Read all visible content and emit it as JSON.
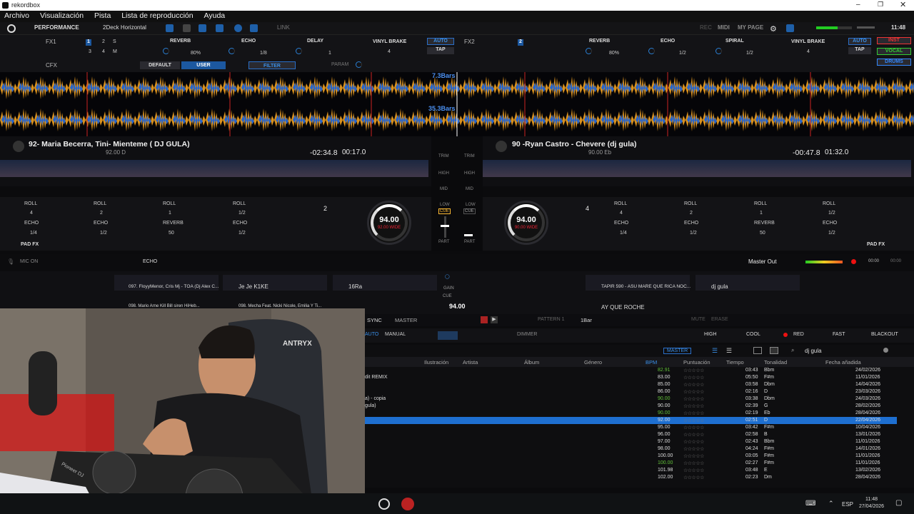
{
  "window": {
    "title": "rekordbox"
  },
  "menu": [
    "Archivo",
    "Visualización",
    "Pista",
    "Lista de reproducción",
    "Ayuda"
  ],
  "toolbar": {
    "mode": "PERFORMANCE",
    "layout": "2Deck Horizontal",
    "link": "LINK",
    "rec": "REC",
    "midi": "MIDI",
    "mypage": "MY PAGE",
    "clock": "11:48"
  },
  "fx": {
    "fx1": "FX1",
    "fx2": "FX2",
    "cfx": "CFX",
    "fx1_slots": [
      {
        "name": "REVERB",
        "val": "80%"
      },
      {
        "name": "ECHO",
        "val": "1/8"
      },
      {
        "name": "DELAY",
        "val": "1"
      },
      {
        "name": "VINYL BRAKE",
        "val": "4"
      }
    ],
    "fx2_slots": [
      {
        "name": "REVERB",
        "val": "80%"
      },
      {
        "name": "ECHO",
        "val": "1/2"
      },
      {
        "name": "SPIRAL",
        "val": "1/2"
      },
      {
        "name": "VINYL BRAKE",
        "val": "4"
      }
    ],
    "auto": "AUTO",
    "tap": "TAP",
    "default": "DEFAULT",
    "user": "USER",
    "filter": "FILTER",
    "param": "PARAM",
    "inst": "INST",
    "vocal": "VOCAL",
    "drums": "DRUMS"
  },
  "waves": {
    "bars1": "7.3Bars",
    "bars2": "35.3Bars"
  },
  "deck1": {
    "num": "1",
    "title": "92- Maria Becerra, Tini- Mienteme ( DJ GULA)",
    "sub": "92.00 D",
    "remain": "-02:34.8",
    "elapsed": "00:17.0",
    "bpm": "94.00",
    "bpm_sub": "92.00 WIDE",
    "loop": "2",
    "pads": [
      [
        "ROLL",
        "4"
      ],
      [
        "ROLL",
        "2"
      ],
      [
        "ROLL",
        "1"
      ],
      [
        "ROLL",
        "1/2"
      ],
      [
        "ECHO",
        "1/4"
      ],
      [
        "ECHO",
        "1/2"
      ],
      [
        "REVERB",
        "50"
      ],
      [
        "ECHO",
        "1/2"
      ]
    ]
  },
  "deck2": {
    "num": "2",
    "title": "90 -Ryan Castro - Chevere (dj gula)",
    "sub": "90.00 Eb",
    "remain": "-00:47.8",
    "elapsed": "01:32.0",
    "bpm": "94.00",
    "bpm_sub": "90.00 WIDE",
    "loop": "4",
    "pads": [
      [
        "ROLL",
        "4"
      ],
      [
        "ROLL",
        "2"
      ],
      [
        "ROLL",
        "1"
      ],
      [
        "ROLL",
        "1/2"
      ],
      [
        "ECHO",
        "1/4"
      ],
      [
        "ECHO",
        "1/2"
      ],
      [
        "REVERB",
        "50"
      ],
      [
        "ECHO",
        "1/2"
      ]
    ]
  },
  "mixer": {
    "trim": "TRIM",
    "high": "HIGH",
    "mid": "MID",
    "low": "LOW",
    "cue": "CUE",
    "part": "PART"
  },
  "strip": {
    "pad_fx": "PAD FX",
    "mic_on": "MIC ON",
    "echo": "ECHO",
    "master_out": "Master Out",
    "time1": "00:00",
    "time2": "00:00"
  },
  "sampler": {
    "left": [
      "097. FloyyMenor, Cris Mj - TOA (Dj Alex C...",
      "Je Je K1KE",
      "16Ra",
      "098. Mario Arne Kill Bill siren HiHeb...",
      "098. Mecha Feat. Nicki Nicole, Emilia Y Ti..."
    ],
    "right": [
      "TAPIR 590 - ASU MARE QUE RICA NOC...",
      "dj gula",
      "AY QUE ROCHE"
    ],
    "gain": "GAIN",
    "cue": "CUE",
    "bpm": "94.00"
  },
  "seq": {
    "sync": "SYNC",
    "master": "MASTER",
    "pattern": "PATTERN 1",
    "bar": "1Bar",
    "mute": "MUTE",
    "erase": "ERASE"
  },
  "filterbar": {
    "auto": "AUTO",
    "manual": "MANUAL",
    "dimmer": "DIMMER",
    "high": "HIGH",
    "cool": "COOL",
    "red": "RED",
    "fast": "FAST",
    "blackout": "BLACKOUT"
  },
  "browser": {
    "master": "MASTER",
    "search": "dj gula",
    "cols": [
      "Ilustración",
      "Artista",
      "Álbum",
      "Género",
      "BPM",
      "Puntuación",
      "Tiempo",
      "Tonalidad",
      "Fecha añadida"
    ],
    "rows": [
      [
        "",
        "82.91",
        "03:43",
        "Bbm",
        "24/02/2026",
        "#63c23a"
      ],
      [
        "dit REMIX",
        "83.00",
        "05:50",
        "F#m",
        "11/01/2026",
        ""
      ],
      [
        "",
        "85.00",
        "03:58",
        "Dbm",
        "14/04/2026",
        ""
      ],
      [
        "",
        "86.00",
        "02:16",
        "D",
        "23/03/2026",
        ""
      ],
      [
        "a) - copia",
        "90.00",
        "03:38",
        "Dbm",
        "24/03/2026",
        "#63c23a"
      ],
      [
        "gula)",
        "90.00",
        "02:39",
        "G",
        "28/02/2026",
        ""
      ],
      [
        "",
        "90.00",
        "02:19",
        "Eb",
        "28/04/2026",
        "#63c23a"
      ],
      [
        "",
        "92.00",
        "02:51",
        "D",
        "22/04/2026",
        "sel"
      ],
      [
        "",
        "95.00",
        "03:42",
        "F#m",
        "10/04/2026",
        ""
      ],
      [
        "",
        "96.00",
        "02:58",
        "B",
        "13/01/2026",
        ""
      ],
      [
        "",
        "97.00",
        "02:43",
        "Bbm",
        "11/01/2026",
        ""
      ],
      [
        "",
        "98.00",
        "04:24",
        "F#m",
        "14/01/2026",
        ""
      ],
      [
        "",
        "100.00",
        "03:05",
        "F#m",
        "11/01/2026",
        ""
      ],
      [
        "",
        "100.00",
        "02:27",
        "F#m",
        "11/01/2026",
        "#63c23a"
      ],
      [
        "",
        "101.98",
        "03:48",
        "E",
        "13/02/2026",
        ""
      ],
      [
        "",
        "102.00",
        "02:23",
        "Dm",
        "28/04/2026",
        ""
      ]
    ]
  },
  "cam": {
    "brand": "ANTRYX",
    "controller": "Pioneer DJ"
  },
  "taskbar": {
    "lang": "ESP",
    "time": "11:48",
    "date": "27/04/2026"
  }
}
